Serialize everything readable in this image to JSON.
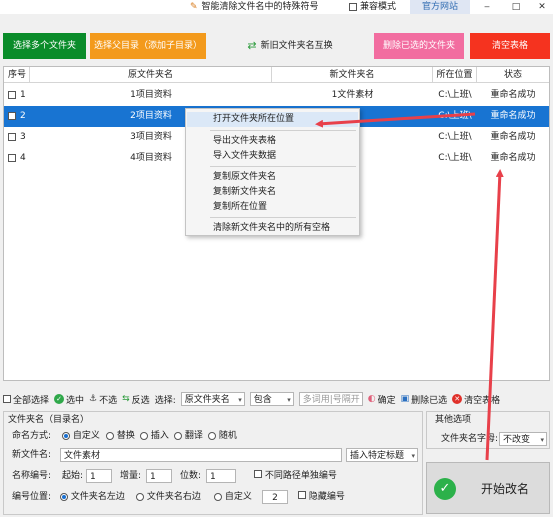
{
  "window": {
    "title": "智能清除文件名中的特殊符号",
    "compat_mode": "兼容模式",
    "official_site": "官方网站",
    "controls": [
      "‒",
      "□",
      "✕"
    ]
  },
  "top_buttons": {
    "add_folders": "选择多个文件夹",
    "parent_dir": "选择父目录（添加子目录）",
    "swap_names": "新旧文件夹名互换",
    "delete_selected": "删除已选的文件夹",
    "clear_table": "清空表格"
  },
  "table": {
    "headers": [
      "序号",
      "原文件夹名",
      "新文件夹名",
      "所在位置",
      "状态"
    ],
    "rows": [
      {
        "num": "1",
        "old": "1项目资料",
        "new": "1文件素材",
        "loc": "C:\\上班\\",
        "status": "重命名成功",
        "selected": false
      },
      {
        "num": "2",
        "old": "2项目资料",
        "new": "材",
        "loc": "C:\\上班\\",
        "status": "重命名成功",
        "selected": true
      },
      {
        "num": "3",
        "old": "3项目资料",
        "new": "材",
        "loc": "C:\\上班\\",
        "status": "重命名成功",
        "selected": false
      },
      {
        "num": "4",
        "old": "4项目资料",
        "new": "材",
        "loc": "C:\\上班\\",
        "status": "重命名成功",
        "selected": false
      }
    ]
  },
  "context_menu": [
    "打开文件夹所在位置",
    "导出文件夹表格",
    "导入文件夹数据",
    "复制原文件夹名",
    "复制新文件夹名",
    "复制所在位置",
    "清除新文件夹名中的所有空格"
  ],
  "toolbar": {
    "select_all": "全部选择",
    "check": "选中",
    "uncheck": "不选",
    "invert": "反选",
    "select_label": "选择:",
    "field_value": "原文件夹名",
    "match_value": "包含",
    "keywords_placeholder": "多词用|号隔开",
    "confirm": "确定",
    "delete_checked": "删除已选",
    "clear_table": "清空表格"
  },
  "panel": {
    "group_title": "文件夹名（目录名）",
    "naming_label": "命名方式:",
    "naming_options": [
      "自定义",
      "替换",
      "插入",
      "翻译",
      "随机"
    ],
    "new_name_label": "新文件名:",
    "new_name_value": "文件素材",
    "insert_title": "插入特定标题",
    "number_label": "名称编号:",
    "start_label": "起始:",
    "start_value": "1",
    "step_label": "增量:",
    "step_value": "1",
    "digits_label": "位数:",
    "digits_value": "1",
    "no_separate": "不同路径单独编号",
    "position_label": "编号位置:",
    "pos_options": [
      "文件夹名左边",
      "文件夹名右边",
      "自定义"
    ],
    "custom_value": "2",
    "hide_number": "隐藏编号"
  },
  "other": {
    "title": "其他选项",
    "case_label": "文件夹名字母:",
    "case_value": "不改变"
  },
  "start_button": "开始改名",
  "colors": {
    "accent": "#1874d2",
    "green_button": "#0a8c2a",
    "orange_button": "#f39a1c",
    "pink_button": "#f26da0",
    "red_button": "#f5331f",
    "arrow": "#e8404a"
  }
}
